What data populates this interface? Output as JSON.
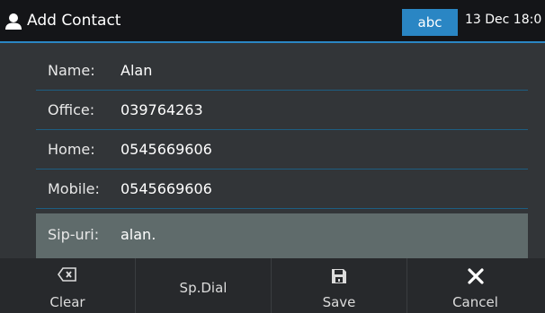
{
  "header": {
    "title": "Add Contact",
    "input_mode": "abc",
    "datetime": "13 Dec 18:0",
    "icon": "user-icon"
  },
  "fields": [
    {
      "label": "Name:",
      "value": "Alan"
    },
    {
      "label": "Office:",
      "value": "039764263"
    },
    {
      "label": "Home:",
      "value": "0545669606"
    },
    {
      "label": "Mobile:",
      "value": "0545669606"
    },
    {
      "label": "Sip-uri:",
      "value": "alan."
    }
  ],
  "softkeys": [
    {
      "label": "Clear",
      "icon": "backspace-icon"
    },
    {
      "label": "Sp.Dial",
      "icon": ""
    },
    {
      "label": "Save",
      "icon": "floppy-disk-icon"
    },
    {
      "label": "Cancel",
      "icon": "close-icon"
    }
  ],
  "colors": {
    "accent": "#2a86c4",
    "background": "#323538",
    "selected_row": "#5f6b6b"
  }
}
